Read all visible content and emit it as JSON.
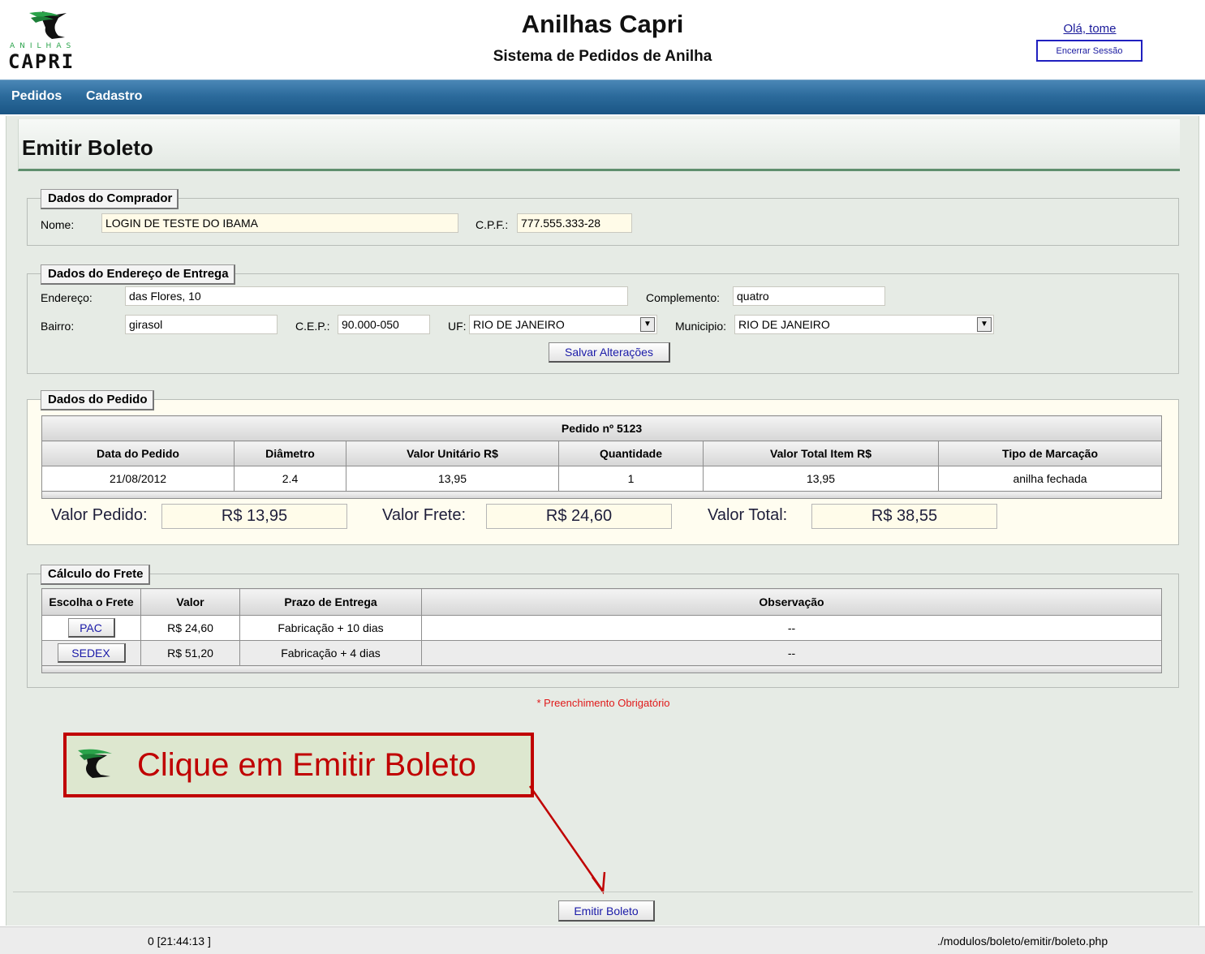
{
  "header": {
    "title": "Anilhas Capri",
    "subtitle": "Sistema de Pedidos de Anilha",
    "greeting": "Olá, tome",
    "logout_label": "Encerrar Sessão",
    "logo": {
      "top_text": "ANILHAS",
      "bottom_text": "CAPRI"
    }
  },
  "nav": {
    "items": [
      "Pedidos",
      "Cadastro"
    ]
  },
  "page": {
    "title": "Emitir Boleto"
  },
  "buyer": {
    "legend": "Dados do Comprador",
    "name_label": "Nome:",
    "name_value": "LOGIN DE TESTE DO IBAMA",
    "cpf_label": "C.P.F.:",
    "cpf_value": "777.555.333-28"
  },
  "address": {
    "legend": "Dados do Endereço de Entrega",
    "endereco_label": "Endereço:",
    "endereco_value": "das Flores, 10",
    "complemento_label": "Complemento:",
    "complemento_value": "quatro",
    "bairro_label": "Bairro:",
    "bairro_value": "girasol",
    "cep_label": "C.E.P.:",
    "cep_value": "90.000-050",
    "uf_label": "UF:",
    "uf_value": "RIO DE JANEIRO",
    "municipio_label": "Municipio:",
    "municipio_value": "RIO DE JANEIRO",
    "save_label": "Salvar Alterações"
  },
  "order": {
    "legend": "Dados do Pedido",
    "caption": "Pedido nº 5123",
    "columns": [
      "Data do Pedido",
      "Diâmetro",
      "Valor Unitário R$",
      "Quantidade",
      "Valor Total Item R$",
      "Tipo de Marcação"
    ],
    "rows": [
      [
        "21/08/2012",
        "2.4",
        "13,95",
        "1",
        "13,95",
        "anilha fechada"
      ]
    ],
    "valor_pedido_label": "Valor Pedido:",
    "valor_pedido": "R$ 13,95",
    "valor_frete_label": "Valor Frete:",
    "valor_frete": "R$ 24,60",
    "valor_total_label": "Valor Total:",
    "valor_total": "R$ 38,55"
  },
  "freight": {
    "legend": "Cálculo do Frete",
    "columns": [
      "Escolha o Frete",
      "Valor",
      "Prazo de Entrega",
      "Observação"
    ],
    "rows": [
      {
        "option": "PAC",
        "valor": "R$ 24,60",
        "prazo": "Fabricação + 10 dias",
        "obs": "--"
      },
      {
        "option": "SEDEX",
        "valor": "R$ 51,20",
        "prazo": "Fabricação + 4 dias",
        "obs": "--"
      }
    ]
  },
  "required_note": "* Preenchimento Obrigatório",
  "callout": {
    "text": "Clique em Emitir Boleto",
    "border_color": "#c00000"
  },
  "emit_label": "Emitir Boleto",
  "status": {
    "left": "0 [21:44:13 ]",
    "right": "./modulos/boleto/emitir/boleto.php"
  },
  "colors": {
    "nav_bar": "#2c6b9c",
    "accent_red": "#c00000",
    "link_blue": "#1a1aa8",
    "content_bg": "#e6ebe5",
    "input_bg": "#fffbe8"
  }
}
